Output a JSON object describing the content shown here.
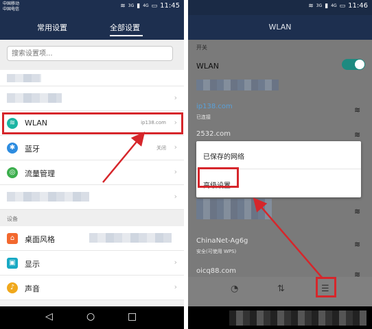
{
  "left": {
    "status": {
      "carrier1": "中国移动",
      "carrier2": "中国电信",
      "time": "11:45",
      "net": "3G",
      "signal": "4G"
    },
    "tabs": {
      "common": "常用设置",
      "all": "全部设置"
    },
    "search": {
      "placeholder": "搜索设置项..."
    },
    "rows": {
      "wlan": {
        "label": "WLAN",
        "value": "ip138.com"
      },
      "bluetooth": {
        "label": "蓝牙",
        "value": "关闭"
      },
      "traffic": {
        "label": "流量管理"
      }
    },
    "section_device": "设备",
    "device_rows": {
      "theme": "桌面风格",
      "display": "显示",
      "sound": "声音"
    }
  },
  "right": {
    "status": {
      "time": "11:46",
      "net": "3G",
      "signal": "4G"
    },
    "title": "WLAN",
    "section_switch": "开关",
    "wlan_label": "WLAN",
    "toggle_on": true,
    "networks": [
      {
        "name": "ip138.com",
        "sub": "已连接"
      },
      {
        "name": "2532.com",
        "sub": ""
      },
      {
        "name": "ChinaNet-Ag6g",
        "sub": "安全(可使用 WPS)"
      },
      {
        "name": "oicq88.com",
        "sub": ""
      }
    ],
    "menu": {
      "saved": "已保存的网络",
      "advanced": "高级设置"
    }
  },
  "colors": {
    "header": "#1d2f4f",
    "highlight": "#d6262b",
    "toggle": "#1e8a80"
  }
}
